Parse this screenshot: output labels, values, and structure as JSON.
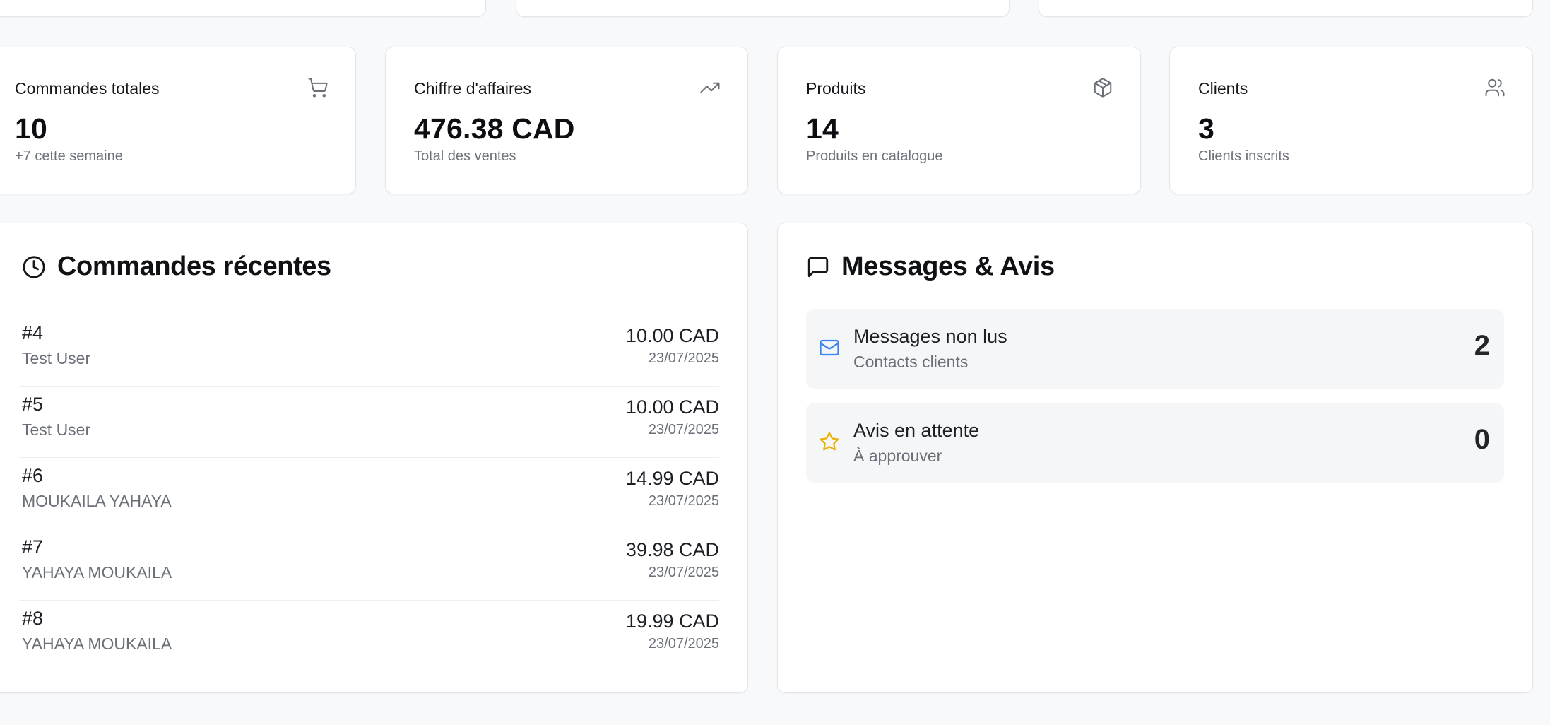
{
  "stats": [
    {
      "title": "Commandes totales",
      "value": "10",
      "sub": "+7 cette semaine",
      "icon": "shopping-cart-icon"
    },
    {
      "title": "Chiffre d'affaires",
      "value": "476.38 CAD",
      "sub": "Total des ventes",
      "icon": "trending-up-icon"
    },
    {
      "title": "Produits",
      "value": "14",
      "sub": "Produits en catalogue",
      "icon": "package-icon"
    },
    {
      "title": "Clients",
      "value": "3",
      "sub": "Clients inscrits",
      "icon": "users-icon"
    }
  ],
  "recent_orders": {
    "title": "Commandes récentes",
    "icon": "clock-icon",
    "rows": [
      {
        "id": "#4",
        "customer": "Test User",
        "amount": "10.00 CAD",
        "date": "23/07/2025"
      },
      {
        "id": "#5",
        "customer": "Test User",
        "amount": "10.00 CAD",
        "date": "23/07/2025"
      },
      {
        "id": "#6",
        "customer": "MOUKAILA YAHAYA",
        "amount": "14.99 CAD",
        "date": "23/07/2025"
      },
      {
        "id": "#7",
        "customer": "YAHAYA MOUKAILA",
        "amount": "39.98 CAD",
        "date": "23/07/2025"
      },
      {
        "id": "#8",
        "customer": "YAHAYA MOUKAILA",
        "amount": "19.99 CAD",
        "date": "23/07/2025"
      }
    ]
  },
  "messages": {
    "title": "Messages & Avis",
    "icon": "message-square-icon",
    "items": [
      {
        "title": "Messages non lus",
        "sub": "Contacts clients",
        "count": "2",
        "icon": "mail-icon",
        "color": "#3b82f6"
      },
      {
        "title": "Avis en attente",
        "sub": "À approuver",
        "count": "0",
        "icon": "star-icon",
        "color": "#eab308"
      }
    ]
  }
}
